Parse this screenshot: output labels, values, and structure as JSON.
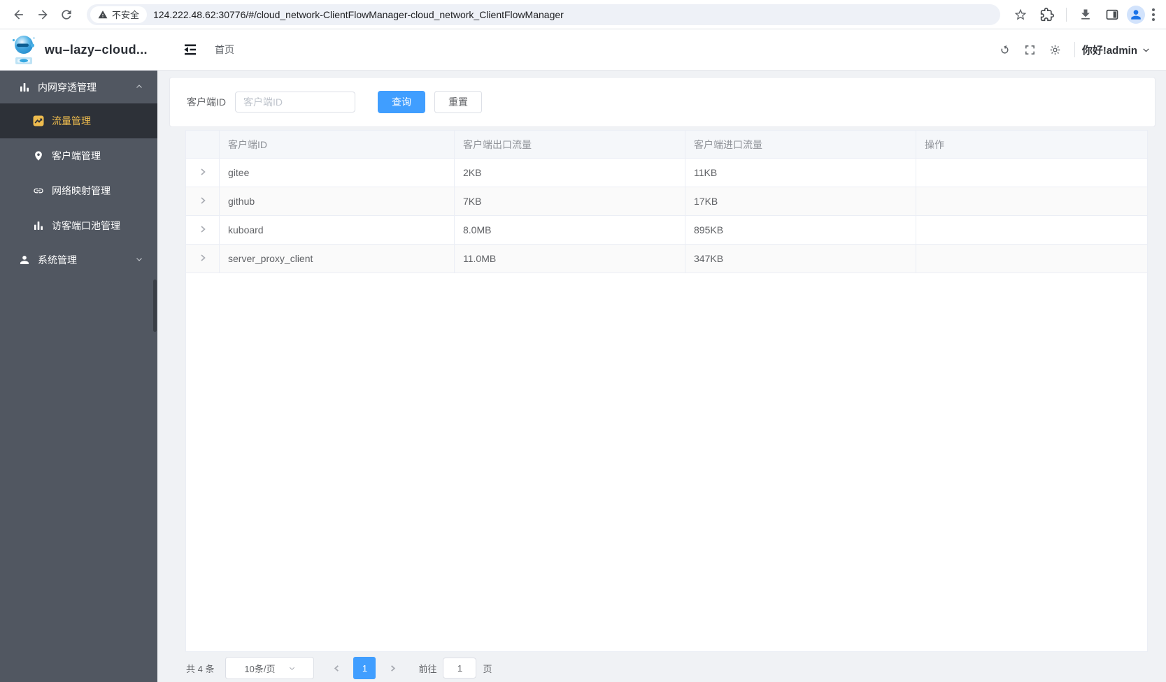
{
  "browser": {
    "security_label": "不安全",
    "url": "124.222.48.62:30776/#/cloud_network-ClientFlowManager-cloud_network_ClientFlowManager"
  },
  "header": {
    "app_title": "wu–lazy–cloud...",
    "breadcrumb": "首页",
    "greeting": "你好!admin"
  },
  "sidebar": {
    "groups": [
      {
        "label": "内网穿透管理",
        "state": "expanded",
        "items": [
          {
            "label": "流量管理",
            "active": true
          },
          {
            "label": "客户端管理",
            "active": false
          },
          {
            "label": "网络映射管理",
            "active": false
          },
          {
            "label": "访客端口池管理",
            "active": false
          }
        ]
      },
      {
        "label": "系统管理",
        "state": "collapsed",
        "items": []
      }
    ]
  },
  "filter": {
    "label": "客户端ID",
    "placeholder": "客户端ID",
    "search_label": "查询",
    "reset_label": "重置"
  },
  "table": {
    "columns": [
      "客户端ID",
      "客户端出口流量",
      "客户端进口流量",
      "操作"
    ],
    "rows": [
      {
        "id": "gitee",
        "out": "2KB",
        "in": "11KB"
      },
      {
        "id": "github",
        "out": "7KB",
        "in": "17KB"
      },
      {
        "id": "kuboard",
        "out": "8.0MB",
        "in": "895KB"
      },
      {
        "id": "server_proxy_client",
        "out": "11.0MB",
        "in": "347KB"
      }
    ]
  },
  "pagination": {
    "total_label": "共 4 条",
    "page_size_label": "10条/页",
    "current_page": "1",
    "goto_label": "前往",
    "goto_value": "1",
    "page_unit_label": "页"
  },
  "icons": {
    "security_warning": "warning-triangle",
    "traffic_manager": "trend-chart",
    "client_manager": "location-pin",
    "network_mapping": "link",
    "port_pool": "histogram",
    "system_manager": "user",
    "user_menu": "chevron-down"
  },
  "colors": {
    "accent_blue": "#409eff",
    "sidebar_bg": "#515761",
    "sidebar_active_bg": "#2d3138",
    "sidebar_active_text": "#eebc4e",
    "table_header_bg": "#f5f7fa",
    "page_bg": "#f0f2f5"
  }
}
